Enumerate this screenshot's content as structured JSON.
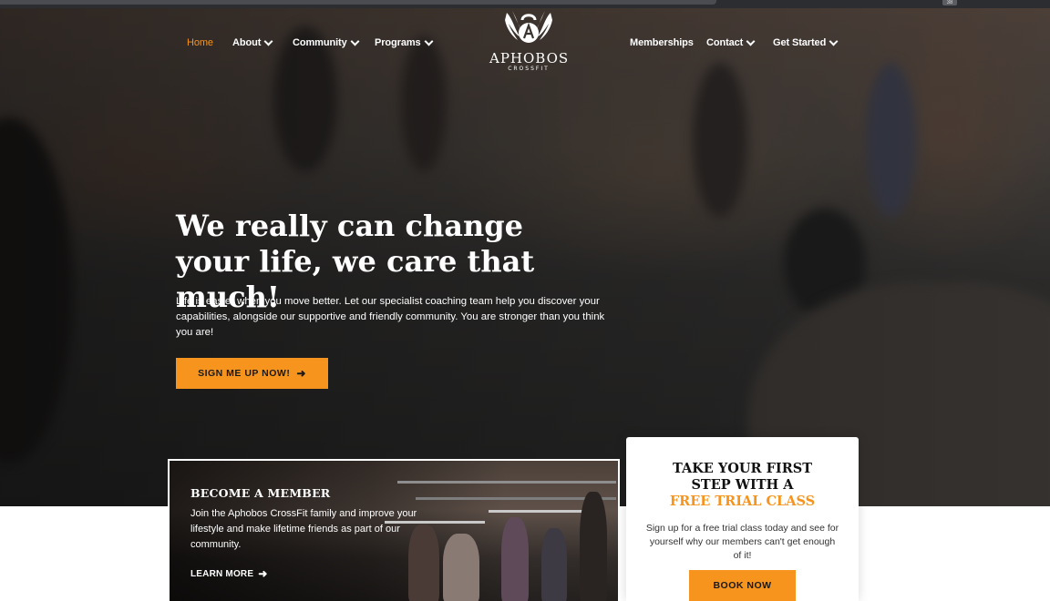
{
  "nav": {
    "left": [
      {
        "label": "Home",
        "active": true,
        "dropdown": false
      },
      {
        "label": "About",
        "active": false,
        "dropdown": true
      },
      {
        "label": "Community",
        "active": false,
        "dropdown": true
      },
      {
        "label": "Programs",
        "active": false,
        "dropdown": true
      }
    ],
    "right": [
      {
        "label": "Memberships",
        "dropdown": false
      },
      {
        "label": "Contact",
        "dropdown": true
      },
      {
        "label": "Get Started",
        "dropdown": true
      }
    ]
  },
  "logo": {
    "name": "APHOBOS",
    "sub": "CROSSFIT",
    "icon": "winged-kettlebell-icon"
  },
  "hero": {
    "title": "We really can change your life, we care that much!",
    "description": "Life is easier when you move better. Let our specialist coaching team help you discover your capabilities, alongside our supportive and friendly community. You are stronger than you think you are!",
    "cta_label": "SIGN ME UP NOW!",
    "cta_icon": "arrow-right-icon"
  },
  "member_card": {
    "title": "BECOME A MEMBER",
    "description": "Join the Aphobos CrossFit family and improve your lifestyle and make lifetime friends as part of our community.",
    "link_label": "LEARN MORE"
  },
  "trial_card": {
    "title_line1": "TAKE YOUR FIRST",
    "title_line2": "STEP WITH A",
    "title_accent": "FREE TRIAL CLASS",
    "description": "Sign up for a free trial class today and see for yourself why our members can't get enough of it!",
    "button_label": "BOOK NOW"
  },
  "colors": {
    "accent": "#f7941d",
    "text_light": "#ffffff",
    "text_dark": "#111111"
  },
  "browser": {
    "badge": "38"
  }
}
